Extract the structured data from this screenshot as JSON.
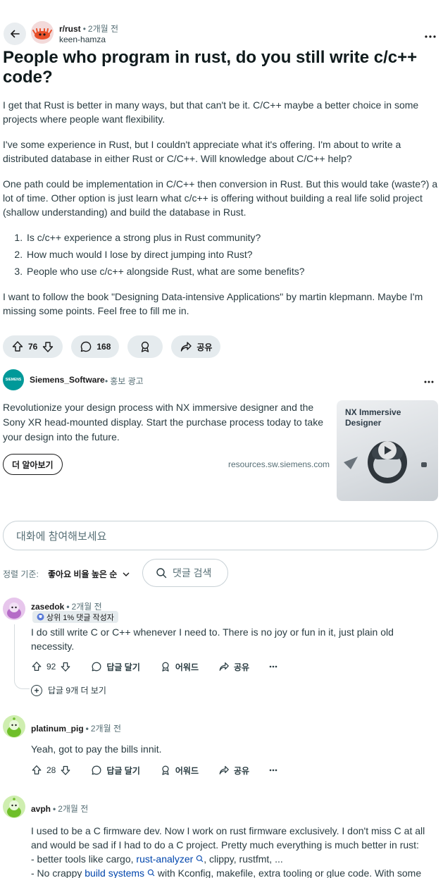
{
  "post": {
    "subreddit": "r/rust",
    "time": "2개월 전",
    "author": "keen-hamza",
    "title": "People who program in rust, do you still write c/c++ code?",
    "paragraphs": [
      "I get that Rust is better in many ways, but that can't be it. C/C++ maybe a better choice in some projects where people want flexibility.",
      "I've some experience in Rust, but I couldn't appreciate what it's offering. I'm about to write a distributed database in either Rust or C/C++. Will knowledge about C/C++ help?",
      "One path could be implementation in C/C++ then conversion in Rust. But this would take (waste?) a lot of time. Other option is just learn what c/c++ is offering without building a real life solid project (shallow understanding) and build the database in Rust."
    ],
    "list": [
      "Is c/c++ experience a strong plus in Rust community?",
      "How much would I lose by direct jumping into Rust?",
      "People who use c/c++ alongside Rust, what are some benefits?"
    ],
    "closing": "I want to follow the book \"Designing Data-intensive Applications\" by martin klepmann. Maybe I'm missing some points. Feel free to fill me in.",
    "votes": "76",
    "comments": "168",
    "share_label": "공유"
  },
  "ad": {
    "advertiser": "Siemens_Software",
    "logo_text": "SIEMENS",
    "tag": "홍보 광고",
    "text": "Revolutionize your design process with NX immersive designer and the Sony XR head-mounted display. Start the purchase process today to take your design into the future.",
    "cta": "더 알아보기",
    "domain": "resources.sw.siemens.com",
    "image_title": "NX Immersive Designer"
  },
  "comment_input": {
    "placeholder": "대화에 참여해보세요"
  },
  "sort": {
    "label": "정렬 기준:",
    "value": "좋아요 비율 높은 순",
    "search_label": "댓글 검색"
  },
  "comments": [
    {
      "author": "zasedok",
      "time": "2개월 전",
      "badge": "상위 1% 댓글 작성자",
      "text": "I do still write C or C++ whenever I need to. There is no joy or fun in it, just plain old necessity.",
      "score": "92",
      "reply": "답글 달기",
      "award": "어워드",
      "share": "공유",
      "more_replies": "답글 9개 더 보기",
      "avatar_color": "#d88fd8"
    },
    {
      "author": "platinum_pig",
      "time": "2개월 전",
      "text": "Yeah, got to pay the bills innit.",
      "score": "28",
      "reply": "답글 달기",
      "award": "어워드",
      "share": "공유",
      "avatar_color": "#8ed84a"
    },
    {
      "author": "avph",
      "time": "2개월 전",
      "text_line1": "I used to be a C firmware dev. Now I work on rust firmware exclusively. I don't miss C at all",
      "text_line2": "and would be sad if I had to do a C project. Pretty much everything is much better in rust:",
      "text_line3_prefix": "- better tools like cargo, ",
      "text_line3_link": "rust-analyzer",
      "text_line3_suffix": ", clippy, rustfmt, ...",
      "text_line4_prefix": "- No crappy ",
      "text_line4_link": "build systems",
      "text_line4_suffix": " with Kconfig, makefile, extra tooling or glue code. With some",
      "avatar_color": "#8ed84a"
    }
  ]
}
